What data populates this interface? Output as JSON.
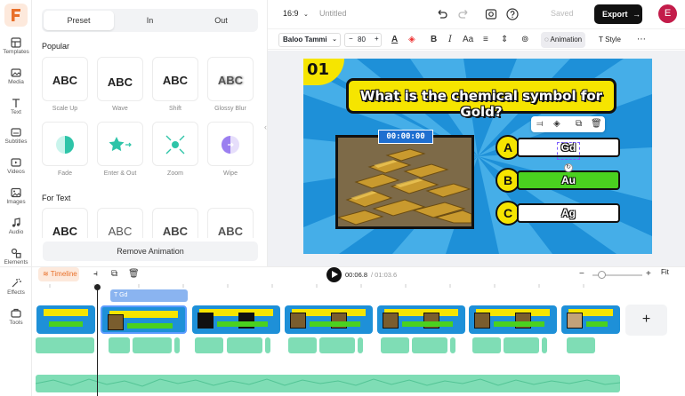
{
  "brand": {
    "logo_letter": "F",
    "accent": "#e8702a"
  },
  "sidebar": {
    "items": [
      {
        "label": "Templates",
        "icon": "templates-icon"
      },
      {
        "label": "Media",
        "icon": "media-icon"
      },
      {
        "label": "Text",
        "icon": "text-icon"
      },
      {
        "label": "Subtitles",
        "icon": "subtitles-icon"
      },
      {
        "label": "Videos",
        "icon": "videos-icon"
      },
      {
        "label": "Images",
        "icon": "images-icon"
      },
      {
        "label": "Audio",
        "icon": "audio-icon"
      },
      {
        "label": "Elements",
        "icon": "elements-icon"
      },
      {
        "label": "Effects",
        "icon": "effects-icon"
      },
      {
        "label": "Tools",
        "icon": "tools-icon"
      }
    ]
  },
  "panel": {
    "tabs": [
      "Preset",
      "In",
      "Out"
    ],
    "active_tab": "Preset",
    "popular_title": "Popular",
    "popular": [
      {
        "label": "Scale Up",
        "sample": "ABC"
      },
      {
        "label": "Wave",
        "sample": "ABC"
      },
      {
        "label": "Shift",
        "sample": "ABC"
      },
      {
        "label": "Glossy Blur",
        "sample": "ABC"
      },
      {
        "label": "Fade",
        "sample": ""
      },
      {
        "label": "Enter & Out",
        "sample": ""
      },
      {
        "label": "Zoom",
        "sample": ""
      },
      {
        "label": "Wipe",
        "sample": ""
      }
    ],
    "for_text_title": "For Text",
    "for_text": [
      {
        "sample": "ABC"
      },
      {
        "sample": "ABC"
      },
      {
        "sample": "ABC"
      },
      {
        "sample": "ABC"
      }
    ],
    "remove_label": "Remove Animation"
  },
  "topbar": {
    "ratio": "16:9",
    "project_title": "Untitled",
    "saved_label": "Saved",
    "export_label": "Export",
    "avatar_letter": "E"
  },
  "format": {
    "font": "Baloo Tammi",
    "size": "80",
    "animation_label": "Animation",
    "style_label": "Style"
  },
  "slide": {
    "number": "01",
    "question": "What is the chemical symbol for Gold?",
    "timer": "00:00:00",
    "options": [
      {
        "letter": "A",
        "text": "Gd",
        "correct": false
      },
      {
        "letter": "B",
        "text": "Au",
        "correct": true
      },
      {
        "letter": "C",
        "text": "Ag",
        "correct": false
      }
    ],
    "colors": {
      "bg": "#1e90d8",
      "yellow": "#f6e500",
      "green": "#4ad11f"
    }
  },
  "timeline": {
    "toggle_label": "Timeline",
    "current_time": "00:06.8",
    "total_time": "/ 01:03.6",
    "fit_label": "Fit",
    "text_clip_label": "Gd",
    "add_label": "+"
  }
}
